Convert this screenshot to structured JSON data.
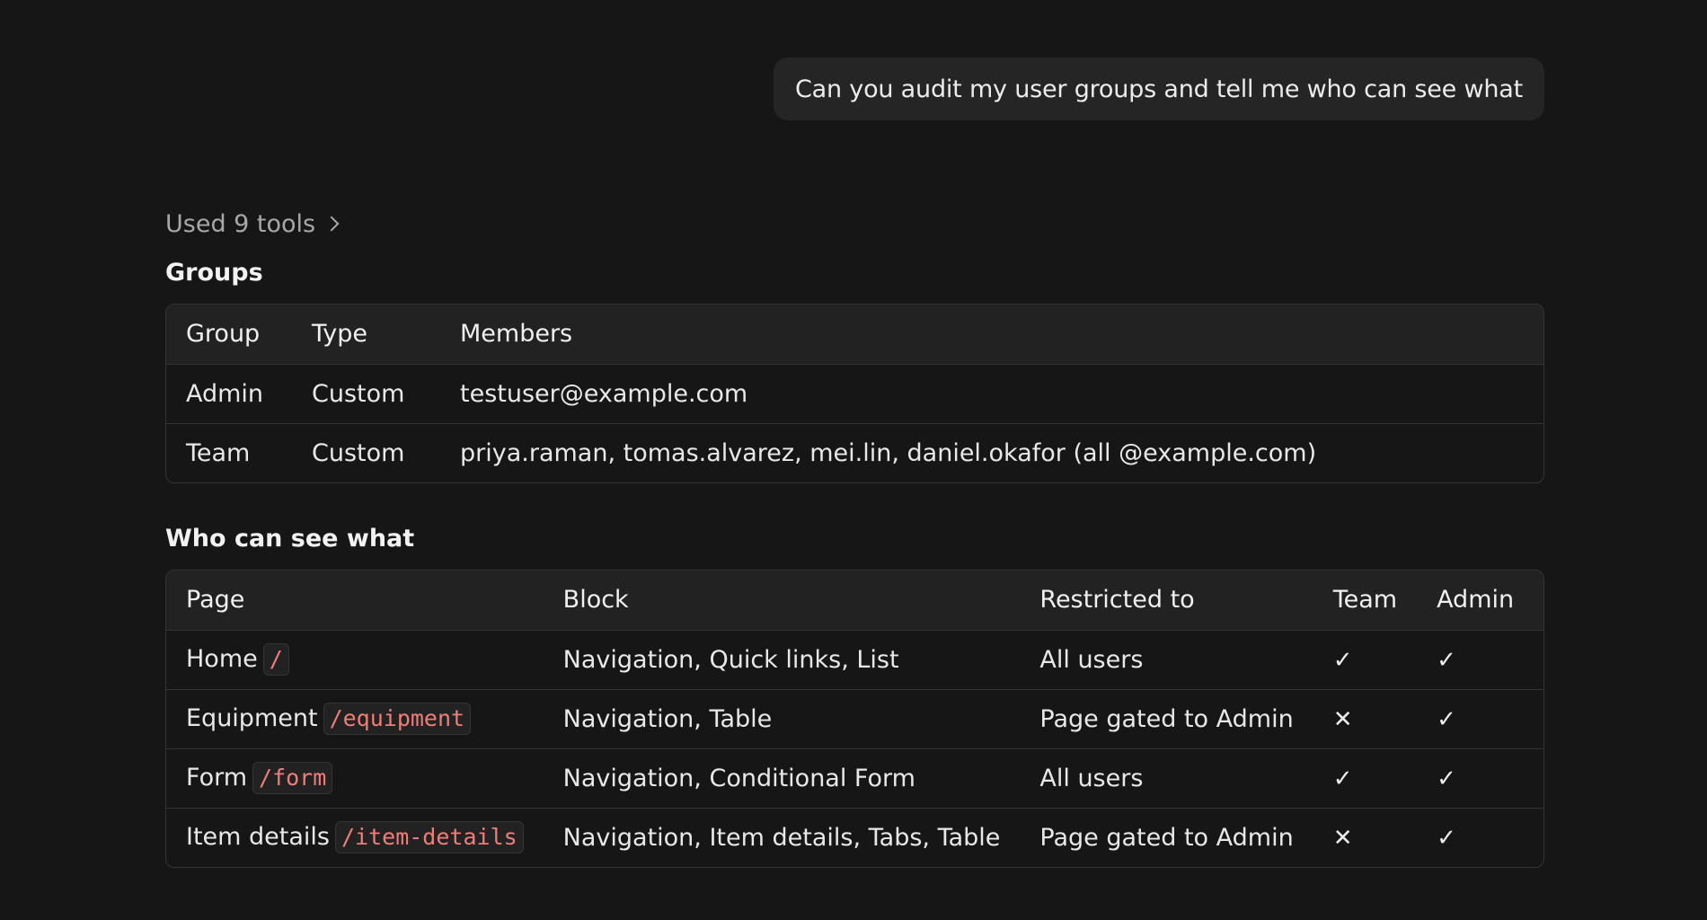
{
  "user_message": "Can you audit my user groups and tell me who can see what",
  "tools_toggle": {
    "label": "Used 9 tools"
  },
  "groups": {
    "title": "Groups",
    "headers": [
      "Group",
      "Type",
      "Members"
    ],
    "rows": [
      {
        "group": "Admin",
        "type": "Custom",
        "members": "testuser@example.com"
      },
      {
        "group": "Team",
        "type": "Custom",
        "members": "priya.raman, tomas.alvarez, mei.lin, daniel.okafor (all @example.com)"
      }
    ]
  },
  "access": {
    "title": "Who can see what",
    "headers": [
      "Page",
      "Block",
      "Restricted to",
      "Team",
      "Admin"
    ],
    "rows": [
      {
        "page": "Home",
        "path": "/",
        "block": "Navigation, Quick links, List",
        "restricted": "All users",
        "team": "✓",
        "admin": "✓"
      },
      {
        "page": "Equipment",
        "path": "/equipment",
        "block": "Navigation, Table",
        "restricted": "Page gated to Admin",
        "team": "✕",
        "admin": "✓"
      },
      {
        "page": "Form",
        "path": "/form",
        "block": "Navigation, Conditional Form",
        "restricted": "All users",
        "team": "✓",
        "admin": "✓"
      },
      {
        "page": "Item details",
        "path": "/item-details",
        "block": "Navigation, Item details, Tabs, Table",
        "restricted": "Page gated to Admin",
        "team": "✕",
        "admin": "✓"
      }
    ]
  },
  "colors": {
    "background": "#161616",
    "bubble": "#252525",
    "code_text": "#ef7e78",
    "muted_text": "#a8a8a8"
  }
}
